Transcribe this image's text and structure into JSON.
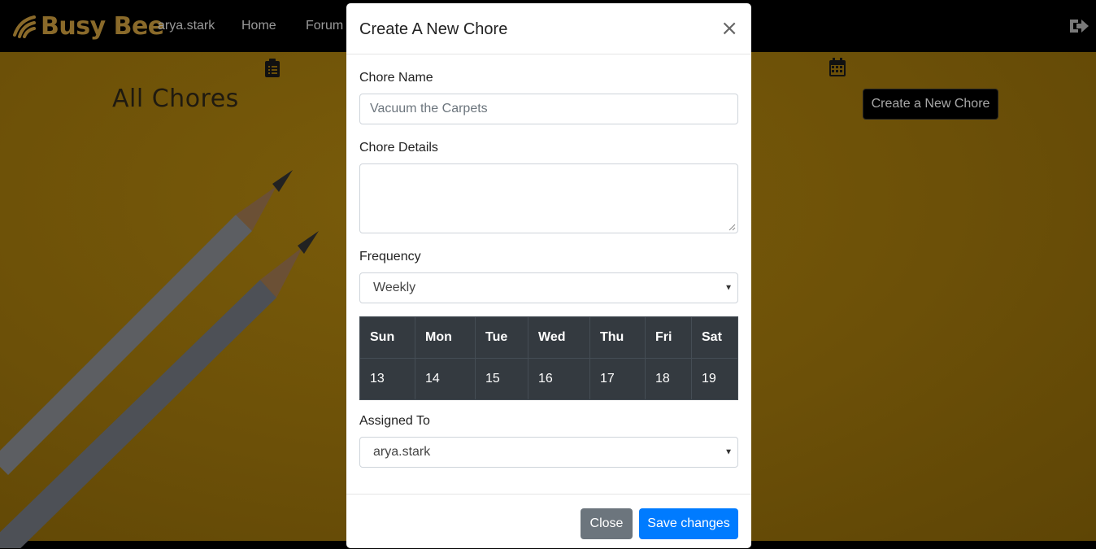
{
  "navbar": {
    "brand": "Busy Bee",
    "username": "arya.stark",
    "links": [
      "Home",
      "Forum"
    ]
  },
  "page": {
    "title": "All Chores",
    "create_button": "Create a New Chore"
  },
  "modal": {
    "title": "Create A New Chore",
    "close_symbol": "×",
    "chore_name": {
      "label": "Chore Name",
      "placeholder": "Vacuum the Carpets"
    },
    "chore_details": {
      "label": "Chore Details",
      "value": ""
    },
    "frequency": {
      "label": "Frequency",
      "selected": "Weekly"
    },
    "week": {
      "days": [
        "Sun",
        "Mon",
        "Tue",
        "Wed",
        "Thu",
        "Fri",
        "Sat"
      ],
      "dates": [
        "13",
        "14",
        "15",
        "16",
        "17",
        "18",
        "19"
      ]
    },
    "assigned_to": {
      "label": "Assigned To",
      "selected": "arya.stark"
    },
    "buttons": {
      "close": "Close",
      "save": "Save changes"
    }
  },
  "colors": {
    "navbar_bg": "#000000",
    "page_bg_dimmed": "#6c5008",
    "primary": "#007bff",
    "secondary": "#6c757d",
    "table_dark": "#343a40"
  },
  "icons": [
    "busy-bee-logo-icon",
    "logout-icon",
    "clipboard-list-icon",
    "calendar-icon",
    "close-icon",
    "chevron-down-icon"
  ]
}
